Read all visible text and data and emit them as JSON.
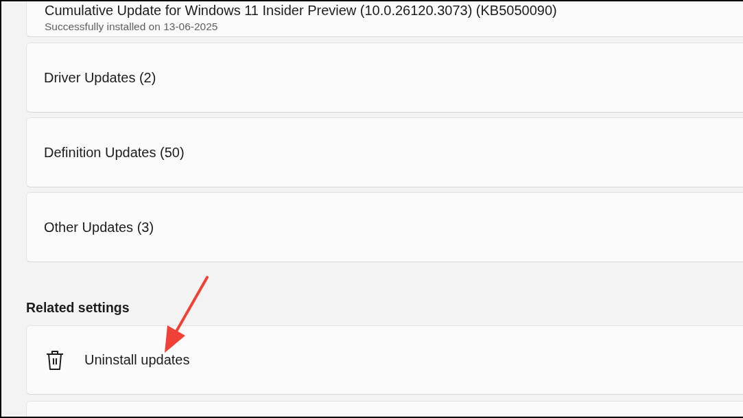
{
  "update_cards": [
    {
      "title": "Cumulative Update for Windows 11 Insider Preview (10.0.26120.3073) (KB5050090)",
      "subtitle": "Successfully installed on 13-06-2025",
      "kind": "item"
    },
    {
      "title": "Driver Updates (2)",
      "kind": "group"
    },
    {
      "title": "Definition Updates (50)",
      "kind": "group"
    },
    {
      "title": "Other Updates (3)",
      "kind": "group"
    }
  ],
  "related_settings": {
    "heading": "Related settings",
    "items": [
      {
        "label": "Uninstall updates",
        "kind": "trash"
      },
      {
        "kind": "blank"
      }
    ]
  }
}
